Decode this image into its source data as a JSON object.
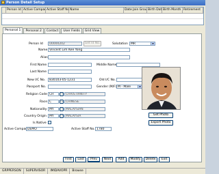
{
  "window": {
    "title": "Person Detail Setup"
  },
  "grid": {
    "columns": [
      "Person Id",
      "Active Company",
      "Active Staff No.",
      "Name",
      "Date Join Group",
      "Birth Date",
      "Birth Month",
      "Retirement"
    ]
  },
  "tabs": [
    "Personal 1",
    "Personal 2",
    "Contact",
    "User Fields",
    "Grid View"
  ],
  "form": {
    "person_id_label": "Person Id",
    "person_id_value": "00000202",
    "get_id_label": "Get Id No.",
    "salutation_label": "Salutation",
    "salutation_value": "MR",
    "name_label": "Name",
    "name_value": "Vincent Lim Kee Yong",
    "alias_label": "Alias",
    "alias_value": "",
    "first_name_label": "First Name",
    "first_name_value": "",
    "middle_name_label": "Middle Name",
    "middle_name_value": "",
    "last_name_label": "Last Name",
    "last_name_value": "",
    "new_ic_label": "New I/C No.",
    "new_ic_value": "830103-05-1231",
    "old_ic_label": "Old I/C No.",
    "old_ic_value": "",
    "passport_label": "Passport No.",
    "passport_value": "",
    "gender_label": "Gender (M/F)",
    "gender_value": "M - Male",
    "religion_label": "Religion Code",
    "religion_code": "CH",
    "religion_desc": "CHRISTIANITY",
    "race_label": "Race",
    "race_code": "C",
    "race_desc": "CHINESE",
    "nationality_label": "Nationality",
    "nationality_code": "MY",
    "nationality_desc": "MALAYSIAN",
    "country_label": "Country Origin",
    "country_code": "MY",
    "country_desc": "MALAYSIA",
    "is_native_label": "Is Native",
    "active_company_label": "Active Company",
    "active_company_value": "DEMO",
    "active_staff_label": "Active Staff No.",
    "active_staff_value": "1780",
    "get_photo_label": "Get Photo",
    "export_photo_label": "Export Photo"
  },
  "nav": {
    "first": "First",
    "last": "Last",
    "prev": "Prev",
    "next": "Next",
    "add": "Add",
    "modify": "Modify",
    "delete": "Delete",
    "exit": "Exit"
  },
  "status": {
    "s1": "GRPPERSON",
    "s2": "SUPERVISOR",
    "s3": "IMIDAVOPR",
    "s4": "Browse"
  }
}
